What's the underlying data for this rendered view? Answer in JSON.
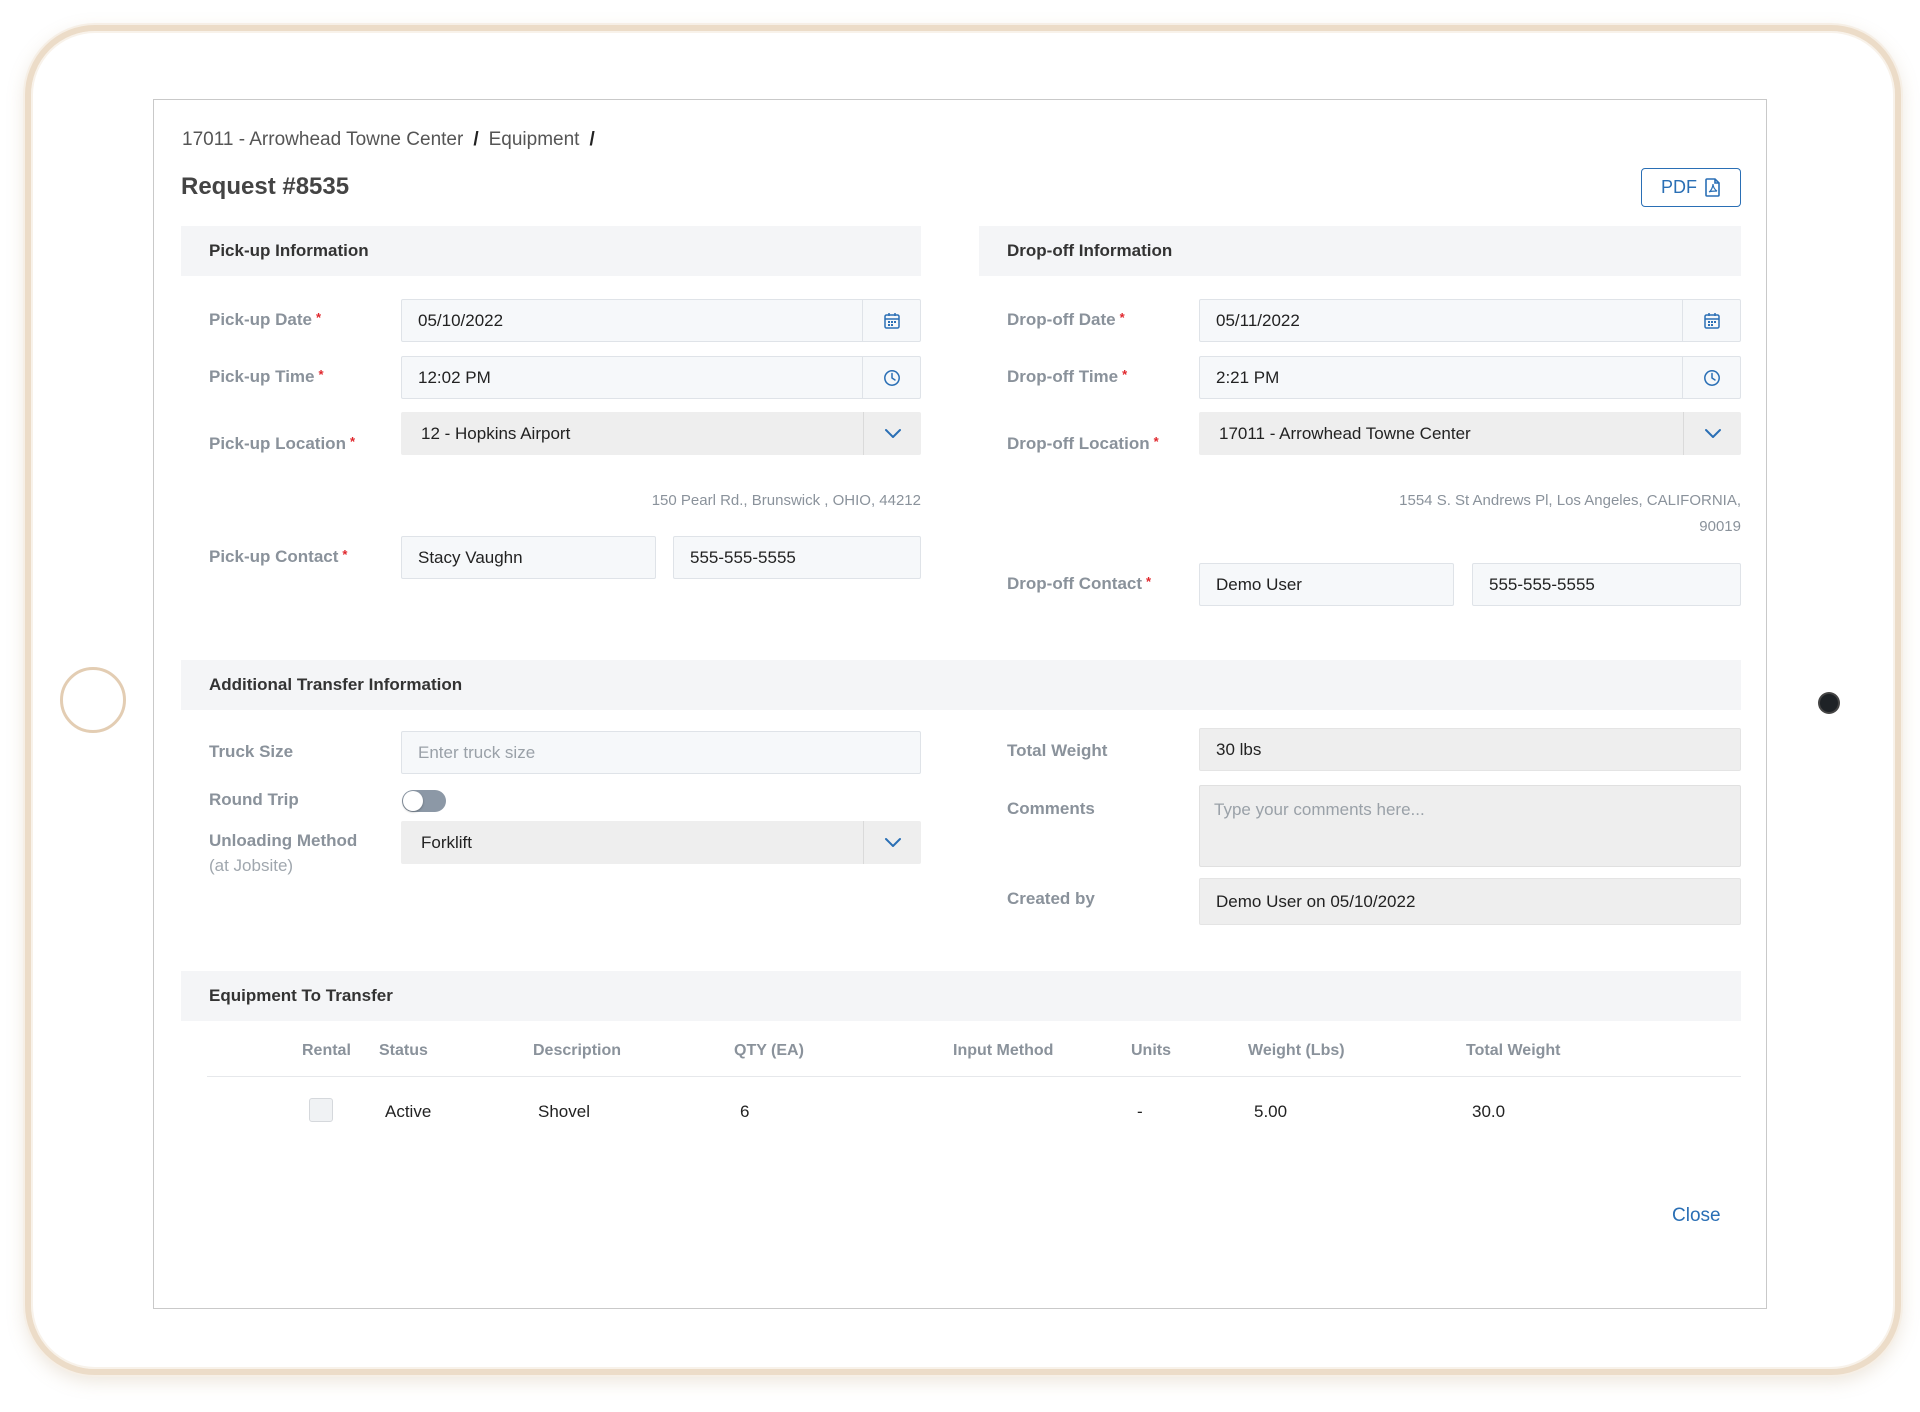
{
  "breadcrumb": {
    "project": "17011 - Arrowhead Towne Center",
    "section": "Equipment"
  },
  "title": "Request #8535",
  "pdf_label": "PDF",
  "pickup": {
    "heading": "Pick-up Information",
    "date_label": "Pick-up Date",
    "date_value": "05/10/2022",
    "time_label": "Pick-up Time",
    "time_value": "12:02 PM",
    "location_label": "Pick-up Location",
    "location_value": "12 - Hopkins Airport",
    "address": "150 Pearl Rd., Brunswick , OHIO, 44212",
    "contact_label": "Pick-up Contact",
    "contact_name": "Stacy Vaughn",
    "contact_phone": "555-555-5555"
  },
  "dropoff": {
    "heading": "Drop-off Information",
    "date_label": "Drop-off Date",
    "date_value": "05/11/2022",
    "time_label": "Drop-off Time",
    "time_value": "2:21 PM",
    "location_label": "Drop-off Location",
    "location_value": "17011 - Arrowhead Towne Center",
    "address_line1": "1554 S. St Andrews Pl, Los Angeles, CALIFORNIA,",
    "address_line2": "90019",
    "contact_label": "Drop-off Contact",
    "contact_name": "Demo User",
    "contact_phone": "555-555-5555"
  },
  "additional": {
    "heading": "Additional Transfer Information",
    "truck_label": "Truck Size",
    "truck_placeholder": "Enter truck size",
    "round_trip_label": "Round Trip",
    "unloading_label": "Unloading Method",
    "unloading_sublabel": "(at Jobsite)",
    "unloading_value": "Forklift",
    "total_weight_label": "Total Weight",
    "total_weight_value": "30 lbs",
    "comments_label": "Comments",
    "comments_placeholder": "Type your comments here...",
    "created_label": "Created by",
    "created_value": "Demo User on 05/10/2022"
  },
  "equipment": {
    "heading": "Equipment To Transfer",
    "columns": [
      "Rental",
      "Status",
      "Description",
      "QTY (EA)",
      "Input Method",
      "Units",
      "Weight (Lbs)",
      "Total Weight"
    ],
    "rows": [
      {
        "status": "Active",
        "description": "Shovel",
        "qty": "6",
        "units": "-",
        "weight": "5.00",
        "total": "30.0"
      }
    ]
  },
  "close_label": "Close",
  "colors": {
    "accent": "#2a6fb5",
    "required": "#e0262c",
    "section_bg": "#f4f5f7"
  },
  "icons": [
    "calendar-icon",
    "clock-icon",
    "chevron-down-icon",
    "pdf-file-icon"
  ]
}
